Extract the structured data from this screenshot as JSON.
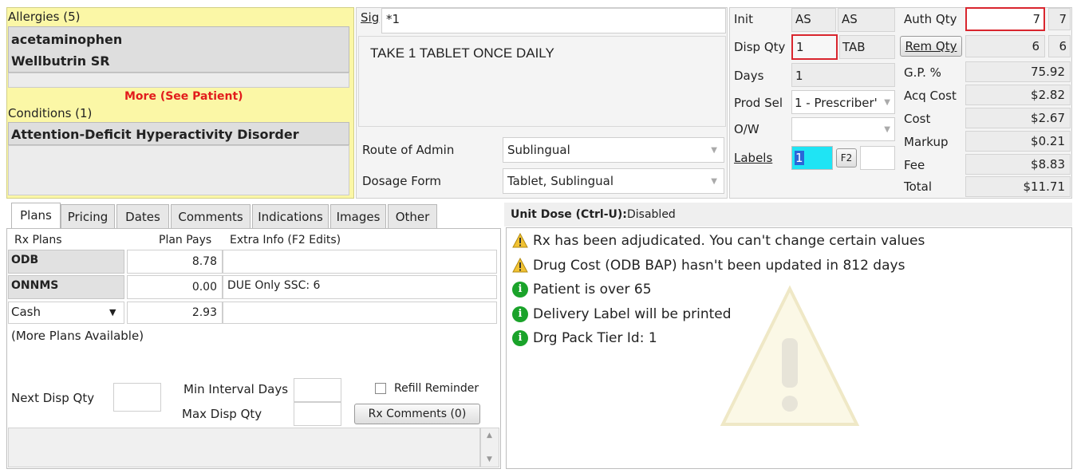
{
  "allergies": {
    "header": "Allergies (5)",
    "items": [
      "acetaminophen",
      "Wellbutrin SR"
    ],
    "more": "More (See Patient)"
  },
  "conditions": {
    "header": "Conditions (1)",
    "items": [
      "Attention-Deficit Hyperactivity Disorder"
    ]
  },
  "sig": {
    "label": "Sig",
    "code": "*1",
    "text": "TAKE 1 TABLET ONCE DAILY"
  },
  "route": {
    "label": "Route of Admin",
    "value": "Sublingual"
  },
  "dosage": {
    "label": "Dosage Form",
    "value": "Tablet, Sublingual"
  },
  "dispense": {
    "init_label": "Init",
    "init1": "AS",
    "init2": "AS",
    "disp_qty_label": "Disp Qty",
    "disp_qty": "1",
    "disp_unit": "TAB",
    "days_label": "Days",
    "days": "1",
    "prod_sel_label": "Prod Sel",
    "prod_sel": "1 - Prescriber'",
    "ow_label": "O/W",
    "ow": "",
    "labels_label": "Labels",
    "labels_value": "1",
    "f2": "F2"
  },
  "pricing": {
    "auth_qty_label": "Auth Qty",
    "auth_qty": "7",
    "auth_qty2": "7",
    "rem_qty_label": "Rem Qty",
    "rem_qty": "6",
    "rem_qty2": "6",
    "gp_label": "G.P. %",
    "gp": "75.92",
    "acq_label": "Acq Cost",
    "acq": "$2.82",
    "cost_label": "Cost",
    "cost": "$2.67",
    "markup_label": "Markup",
    "markup": "$0.21",
    "fee_label": "Fee",
    "fee": "$8.83",
    "total_label": "Total",
    "total": "$11.71"
  },
  "tabs": [
    "Plans",
    "Pricing",
    "Dates",
    "Comments",
    "Indications",
    "Images",
    "Other"
  ],
  "plans": {
    "col1": "Rx Plans",
    "col2": "Plan Pays",
    "col3": "Extra Info (F2 Edits)",
    "rows": [
      {
        "name": "ODB",
        "pays": "8.78",
        "extra": ""
      },
      {
        "name": "ONNMS",
        "pays": "0.00",
        "extra": "DUE Only SSC: 6"
      },
      {
        "name": "Cash",
        "pays": "2.93",
        "extra": ""
      }
    ],
    "more": "(More Plans Available)",
    "next_disp_label": "Next Disp Qty",
    "min_interval_label": "Min Interval Days",
    "max_disp_label": "Max Disp Qty",
    "refill_label": "Refill Reminder",
    "rx_comments": "Rx Comments (0)"
  },
  "unit_dose": {
    "label": "Unit Dose (Ctrl-U):",
    "value": "Disabled"
  },
  "messages": [
    {
      "type": "warning",
      "text": "Rx has been adjudicated. You can't change certain values"
    },
    {
      "type": "warning",
      "text": "Drug Cost (ODB BAP) hasn't been updated in 812 days"
    },
    {
      "type": "info",
      "text": "Patient is over 65"
    },
    {
      "type": "info",
      "text": "Delivery Label will be printed"
    },
    {
      "type": "info",
      "text": "Drg Pack Tier Id: 1"
    }
  ],
  "colors": {
    "yellow_panel": "#fbf7a6",
    "highlight_red": "#d9262e",
    "label_cyan": "#1fe4f4",
    "info_green": "#1aa32a",
    "warn_amber": "#f1c232"
  }
}
